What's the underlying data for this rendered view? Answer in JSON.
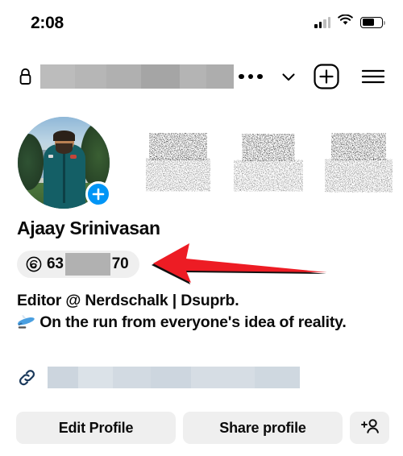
{
  "status_bar": {
    "time": "2:08",
    "signal_icon": "cellular-signal-icon",
    "wifi_icon": "wifi-icon",
    "battery_icon": "battery-icon",
    "battery_level": 62
  },
  "nav": {
    "lock_icon": "lock-icon",
    "username_redacted": true,
    "more_icon": "three-dots-icon",
    "chevron_icon": "chevron-down-icon",
    "add_icon": "plus-square-icon",
    "menu_icon": "hamburger-menu-icon"
  },
  "profile": {
    "avatar_name": "profile-photo",
    "add_story_icon": "plus-circle-icon",
    "name": "Ajaay Srinivasan",
    "stats_obscured": [
      "posts",
      "followers",
      "following"
    ],
    "threads_badge": {
      "icon": "threads-logo-icon",
      "prefix": "63",
      "suffix": "70",
      "redacted": true
    },
    "bio_line_1": "Editor @ Nerdschalk | Dsuprb.",
    "bio_emoji": "airplane-emoji",
    "bio_line_2": " On the run from everyone's idea of reality.",
    "link_icon": "link-icon",
    "link_redacted": true
  },
  "actions": {
    "edit_profile": "Edit Profile",
    "share_profile": "Share profile",
    "add_person_icon": "add-person-icon"
  },
  "annotation": {
    "arrow_icon": "red-arrow-pointing-left",
    "arrow_color": "#ED1C24"
  },
  "colors": {
    "accent_blue": "#0095F6",
    "button_gray": "#efefef",
    "redaction_gray": "#b1b1b1",
    "redaction_blue": "#d3dae1",
    "text": "#0b0b0b"
  }
}
